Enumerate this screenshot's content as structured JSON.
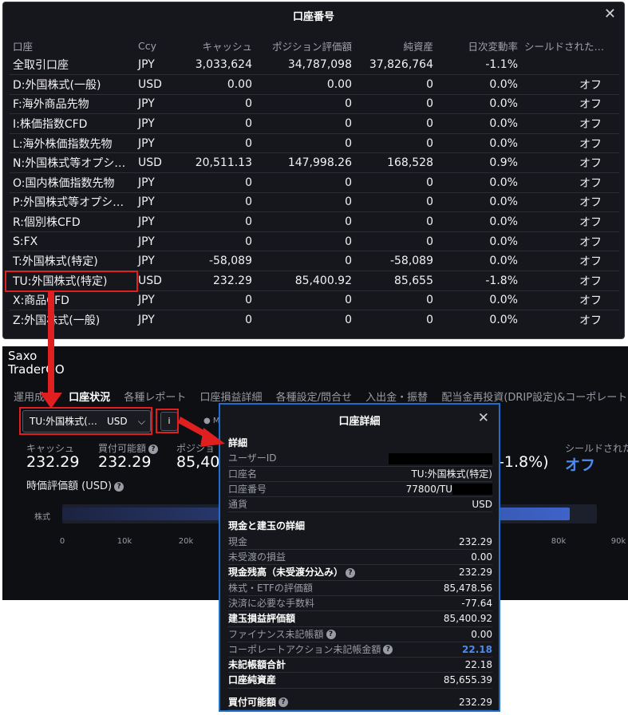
{
  "accounts_panel": {
    "title": "口座番号",
    "columns": [
      "口座",
      "Ccy",
      "キャッシュ",
      "ポジション評価額",
      "純資産",
      "日次変動率",
      "シールドされた…"
    ],
    "rows": [
      {
        "name": "全取引口座",
        "ccy": "JPY",
        "cash": "3,033,624",
        "position": "34,787,098",
        "net": "37,826,764",
        "change": "-1.1%",
        "shield": ""
      },
      {
        "name": "D:外国株式(一般)",
        "ccy": "USD",
        "cash": "0.00",
        "position": "0.00",
        "net": "0",
        "change": "0.0%",
        "shield": "オフ"
      },
      {
        "name": "F:海外商品先物",
        "ccy": "JPY",
        "cash": "0",
        "position": "0",
        "net": "0",
        "change": "0.0%",
        "shield": "オフ"
      },
      {
        "name": "I:株価指数CFD",
        "ccy": "JPY",
        "cash": "0",
        "position": "0",
        "net": "0",
        "change": "0.0%",
        "shield": "オフ"
      },
      {
        "name": "L:海外株価指数先物",
        "ccy": "JPY",
        "cash": "0",
        "position": "0",
        "net": "0",
        "change": "0.0%",
        "shield": "オフ"
      },
      {
        "name": "N:外国株式等オプシ…",
        "ccy": "USD",
        "cash": "20,511.13",
        "position": "147,998.26",
        "net": "168,528",
        "change": "0.9%",
        "shield": "オフ"
      },
      {
        "name": "O:国内株価指数先物",
        "ccy": "JPY",
        "cash": "0",
        "position": "0",
        "net": "0",
        "change": "0.0%",
        "shield": "オフ"
      },
      {
        "name": "P:外国株式等オプシ…",
        "ccy": "JPY",
        "cash": "0",
        "position": "0",
        "net": "0",
        "change": "0.0%",
        "shield": "オフ"
      },
      {
        "name": "R:個別株CFD",
        "ccy": "JPY",
        "cash": "0",
        "position": "0",
        "net": "0",
        "change": "0.0%",
        "shield": "オフ"
      },
      {
        "name": "S:FX",
        "ccy": "JPY",
        "cash": "0",
        "position": "0",
        "net": "0",
        "change": "0.0%",
        "shield": "オフ"
      },
      {
        "name": "T:外国株式(特定)",
        "ccy": "JPY",
        "cash": "-58,089",
        "position": "0",
        "net": "-58,089",
        "change": "0.0%",
        "shield": "オフ"
      },
      {
        "name": "TU:外国株式(特定)",
        "ccy": "USD",
        "cash": "232.29",
        "position": "85,400.92",
        "net": "85,655",
        "change": "-1.8%",
        "shield": "オフ"
      },
      {
        "name": "X:商品CFD",
        "ccy": "JPY",
        "cash": "0",
        "position": "0",
        "net": "0",
        "change": "0.0%",
        "shield": "オフ"
      },
      {
        "name": "Z:外国株式(一般)",
        "ccy": "JPY",
        "cash": "0",
        "position": "0",
        "net": "0",
        "change": "0.0%",
        "shield": "オフ"
      }
    ]
  },
  "app": {
    "brand_line1": "Saxo",
    "brand_line2": "TraderGO",
    "nav": [
      "運用成…",
      "口座状況",
      "各種レポート",
      "口座損益詳細",
      "各種設定/問合せ",
      "入出金・振替",
      "配当金再投資(DRIP設定)&コーポレートア"
    ],
    "nav_active": 1,
    "account_select": {
      "value": "TU:外国株式(…",
      "ccy": "USD"
    },
    "info_label": "i",
    "pin_label": "M",
    "kpis": {
      "cash_label": "キャッシュ",
      "cash_value": "232.29",
      "buying_label": "買付可能額",
      "buying_value": "232.29",
      "position_label": "ポジショ",
      "position_value": "85,40",
      "change_value": "-1.8%)",
      "shield_label": "シールドされた",
      "shield_value": "オフ"
    },
    "section_label": "時価評価額 (USD)",
    "bar_label": "株式",
    "bar_value": 85400.92,
    "bar_max": 90000,
    "ticks": [
      "0",
      "10k",
      "20k",
      "80k",
      "90k"
    ]
  },
  "detail": {
    "title": "口座詳細",
    "rows": [
      {
        "type": "head",
        "k": "詳細"
      },
      {
        "k": "ユーザーID",
        "v": "",
        "redact": 130
      },
      {
        "k": "口座名",
        "v": "TU:外国株式(特定)"
      },
      {
        "k": "口座番号",
        "v": "77800/TU",
        "redact_after": 50
      },
      {
        "k": "通貨",
        "v": "USD"
      },
      {
        "type": "head",
        "k": "現金と建玉の詳細",
        "gap": true
      },
      {
        "k": "現金",
        "v": "232.29"
      },
      {
        "k": "未受渡の損益",
        "v": "0.00"
      },
      {
        "type": "bold",
        "k": "現金残高（未受渡分込み）",
        "v": "232.29",
        "help": true
      },
      {
        "k": "株式・ETFの評価額",
        "v": "85,478.56"
      },
      {
        "k": "決済に必要な手数料",
        "v": "-77.64"
      },
      {
        "type": "bold",
        "k": "建玉損益評価額",
        "v": "85,400.92"
      },
      {
        "k": "ファイナンス未記帳額",
        "v": "0.00",
        "help": true
      },
      {
        "k": "コーポレートアクション未記帳金額",
        "v": "22.18",
        "help": true,
        "accent": true
      },
      {
        "type": "bold",
        "k": "未記帳額合計",
        "v": "22.18"
      },
      {
        "type": "bold",
        "k": "口座純資産",
        "v": "85,655.39"
      },
      {
        "type": "bold",
        "k": "買付可能額",
        "v": "232.29",
        "help": true,
        "gap": true
      }
    ]
  },
  "icons": {
    "close": "close-icon",
    "chevron": "chevron-down-icon",
    "help": "help-icon",
    "info": "info-icon",
    "pin": "pin-icon"
  },
  "colors": {
    "highlight": "#e02020",
    "modal_border": "#1f6fd1",
    "accent": "#4b8cf0",
    "bg": "#16171c"
  }
}
